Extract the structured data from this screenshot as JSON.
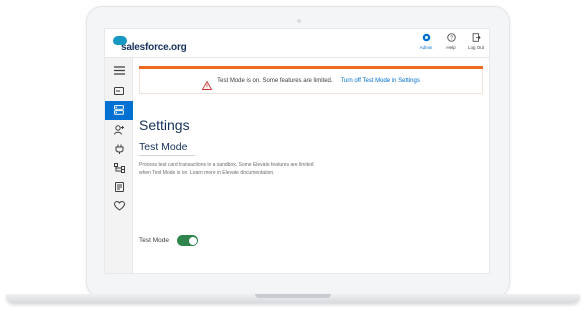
{
  "header": {
    "logo_text": "salesforce.org",
    "actions": [
      {
        "label": "Admin",
        "icon": "gear-icon",
        "active": true
      },
      {
        "label": "Help",
        "icon": "help-icon",
        "active": false
      },
      {
        "label": "Log Out",
        "icon": "logout-icon",
        "active": false
      }
    ]
  },
  "sidebar": {
    "items": [
      {
        "icon": "menu-icon",
        "active": false
      },
      {
        "icon": "card-icon",
        "active": false
      },
      {
        "icon": "settings-list-icon",
        "active": true
      },
      {
        "icon": "add-user-icon",
        "active": false
      },
      {
        "icon": "plug-icon",
        "active": false
      },
      {
        "icon": "hierarchy-icon",
        "active": false
      },
      {
        "icon": "form-icon",
        "active": false
      },
      {
        "icon": "heart-icon",
        "active": false
      }
    ]
  },
  "banner": {
    "message": "Test Mode is on. Some features are limited.",
    "link": "Turn off Test Mode in Settings"
  },
  "main": {
    "page_title": "Settings",
    "section_title": "Test Mode",
    "description": "Process test card transactions in a sandbox. Some Elevate features are limited when Test Mode is on. Learn more in Elevate documentation.",
    "toggle_label": "Test Mode",
    "toggle_on": true
  },
  "colors": {
    "accent": "#0070d2",
    "warning_bar": "#ee6a1f",
    "toggle_on": "#2e844a",
    "title": "#16325c"
  }
}
